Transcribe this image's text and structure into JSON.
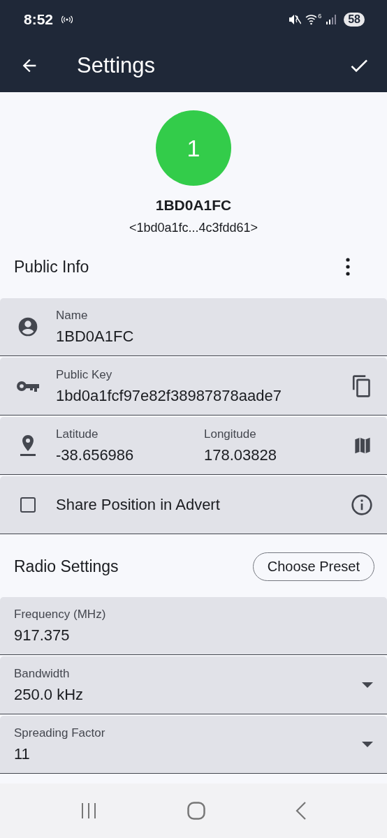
{
  "status_bar": {
    "time": "8:52",
    "wifi_badge": "6",
    "battery": "58"
  },
  "app_bar": {
    "title": "Settings"
  },
  "profile": {
    "avatar": "1",
    "name": "1BD0A1FC",
    "key_short": "<1bd0a1fc...4c3fdd61>"
  },
  "public_info": {
    "title": "Public Info",
    "name_field": {
      "label": "Name",
      "value": "1BD0A1FC"
    },
    "public_key_field": {
      "label": "Public Key",
      "value": "1bd0a1fcf97e82f38987878aade7"
    },
    "latitude": {
      "label": "Latitude",
      "value": "-38.656986"
    },
    "longitude": {
      "label": "Longitude",
      "value": "178.03828"
    },
    "share_position": {
      "label": "Share Position in Advert",
      "checked": false
    }
  },
  "radio_settings": {
    "title": "Radio Settings",
    "preset_button": "Choose Preset",
    "frequency": {
      "label": "Frequency (MHz)",
      "value": "917.375"
    },
    "bandwidth": {
      "label": "Bandwidth",
      "value": "250.0 kHz"
    },
    "spreading_factor": {
      "label": "Spreading Factor",
      "value": "11"
    }
  }
}
